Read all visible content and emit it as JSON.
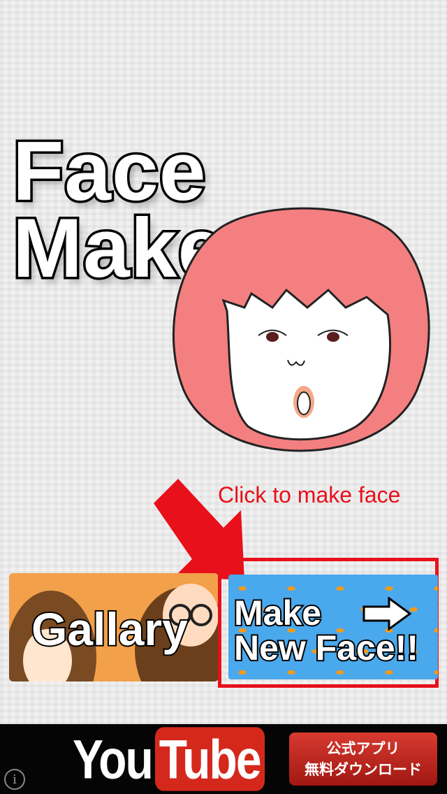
{
  "title": {
    "line1": "Face",
    "line2": "Maker :)"
  },
  "hint": "Click to make face",
  "buttons": {
    "gallery_label": "Gallary",
    "new_face_line1": "Make",
    "new_face_line2": "New Face!!"
  },
  "footer": {
    "youtube_you": "You",
    "youtube_tube": "Tube",
    "download_line1": "公式アプリ",
    "download_line2": "無料ダウンロード"
  },
  "info_icon": "i",
  "colors": {
    "accent_red": "#e8101a",
    "hair_pink": "#f47f80",
    "gallery_orange": "#f2a04a",
    "new_face_blue": "#4aa8ec",
    "youtube_red": "#d5281c"
  }
}
